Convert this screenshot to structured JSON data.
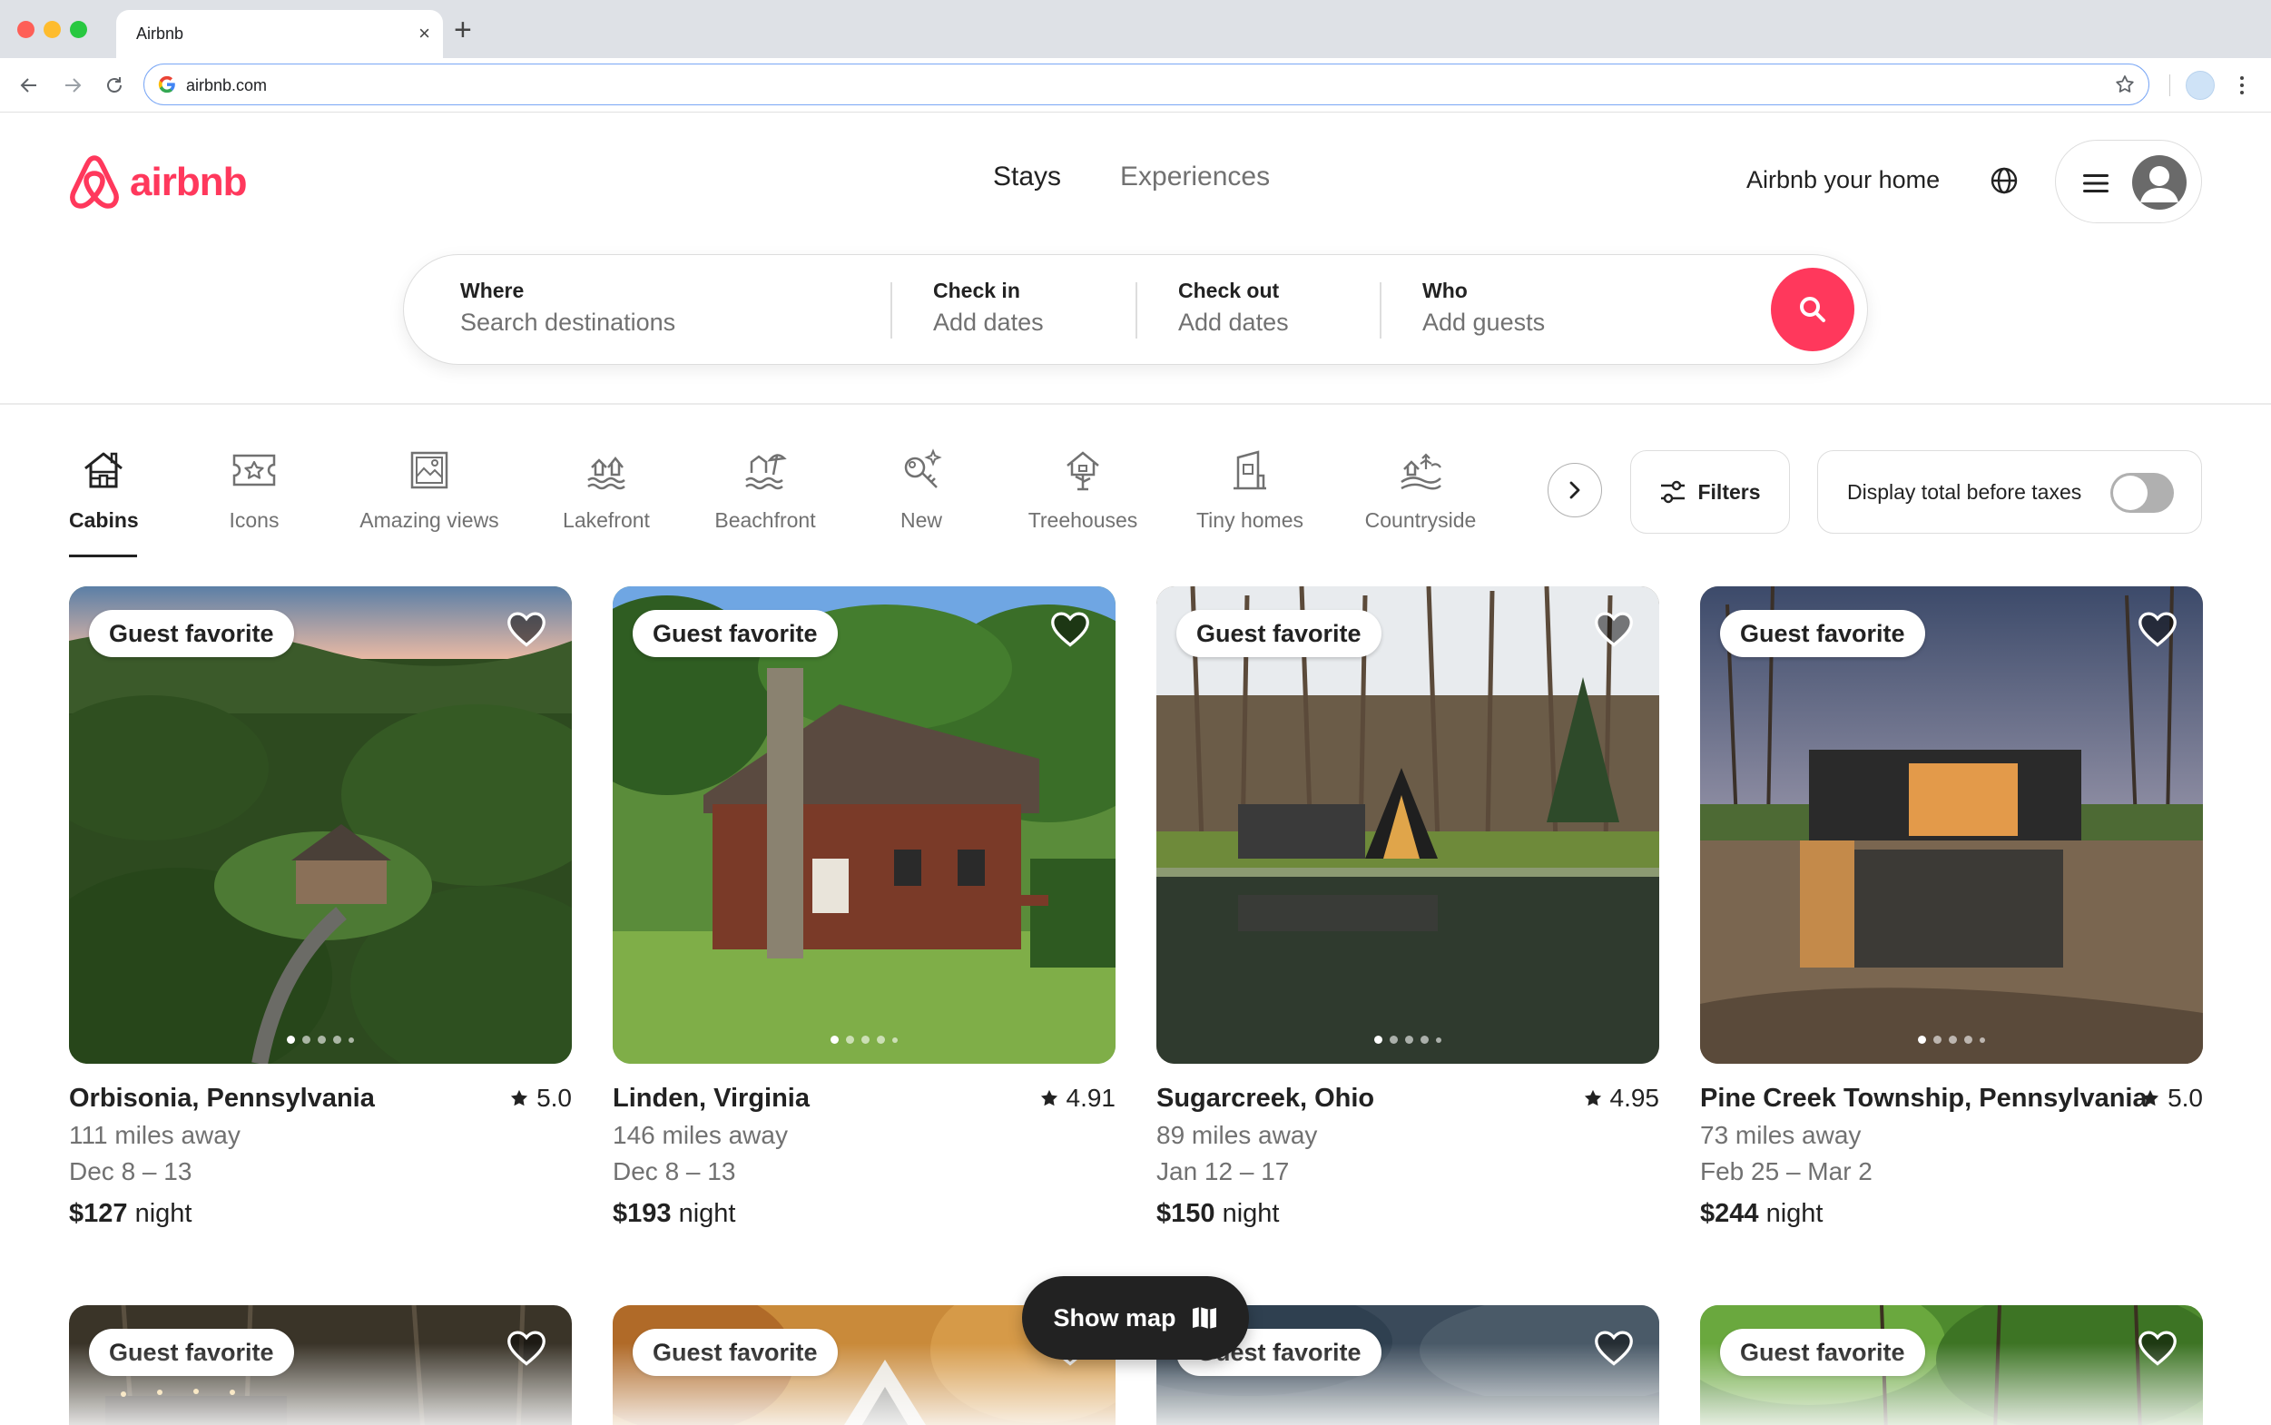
{
  "browser": {
    "tab_title": "Airbnb",
    "url": "airbnb.com"
  },
  "header": {
    "brand": "airbnb",
    "brand_color": "#ff385c",
    "nav": {
      "stays": "Stays",
      "experiences": "Experiences"
    },
    "host_link": "Airbnb your home"
  },
  "search": {
    "where_label": "Where",
    "where_placeholder": "Search destinations",
    "checkin_label": "Check in",
    "checkin_value": "Add dates",
    "checkout_label": "Check out",
    "checkout_value": "Add dates",
    "who_label": "Who",
    "who_value": "Add guests"
  },
  "categories": [
    {
      "label": "Cabins",
      "icon": "cabin-icon",
      "active": true
    },
    {
      "label": "Icons",
      "icon": "ticket-star-icon"
    },
    {
      "label": "Amazing views",
      "icon": "framed-view-icon"
    },
    {
      "label": "Lakefront",
      "icon": "lakefront-icon"
    },
    {
      "label": "Beachfront",
      "icon": "beach-umbrella-icon"
    },
    {
      "label": "New",
      "icon": "new-key-icon"
    },
    {
      "label": "Treehouses",
      "icon": "treehouse-icon"
    },
    {
      "label": "Tiny homes",
      "icon": "tiny-home-icon"
    },
    {
      "label": "Countryside",
      "icon": "countryside-icon"
    }
  ],
  "filters": {
    "label": "Filters"
  },
  "tax_toggle": {
    "label": "Display total before taxes",
    "on": false
  },
  "listings": [
    {
      "badge": "Guest favorite",
      "location": "Orbisonia, Pennsylvania",
      "rating": "5.0",
      "distance": "111 miles away",
      "dates": "Dec 8 – 13",
      "price": "$127",
      "price_unit": "night"
    },
    {
      "badge": "Guest favorite",
      "location": "Linden, Virginia",
      "rating": "4.91",
      "distance": "146 miles away",
      "dates": "Dec 8 – 13",
      "price": "$193",
      "price_unit": "night"
    },
    {
      "badge": "Guest favorite",
      "location": "Sugarcreek, Ohio",
      "rating": "4.95",
      "distance": "89 miles away",
      "dates": "Jan 12 – 17",
      "price": "$150",
      "price_unit": "night"
    },
    {
      "badge": "Guest favorite",
      "location": "Pine Creek Township, Pennsylvania",
      "rating": "5.0",
      "distance": "73 miles away",
      "dates": "Feb 25 – Mar 2",
      "price": "$244",
      "price_unit": "night"
    }
  ],
  "listings_row2": [
    {
      "badge": "Guest favorite"
    },
    {
      "badge": "Guest favorite"
    },
    {
      "badge": "Guest favorite"
    },
    {
      "badge": "Guest favorite"
    }
  ],
  "show_map": {
    "label": "Show map"
  }
}
